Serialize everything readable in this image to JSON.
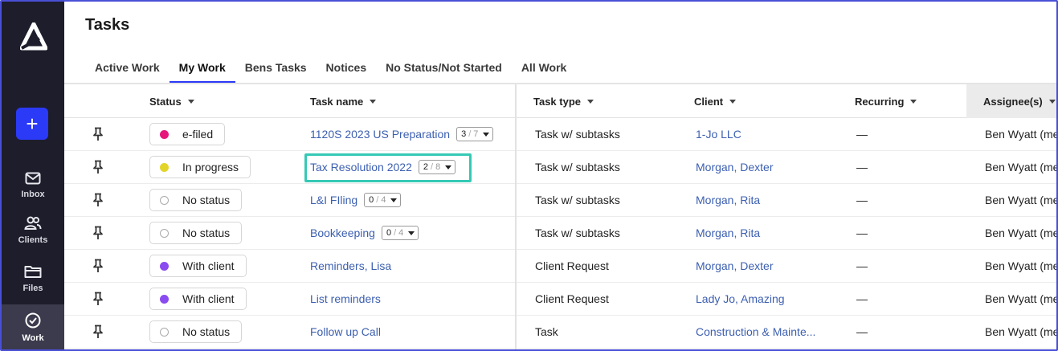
{
  "page": {
    "title": "Tasks"
  },
  "sidebar": {
    "add_label": "+",
    "items": [
      {
        "label": "Inbox",
        "icon": "envelope-icon"
      },
      {
        "label": "Clients",
        "icon": "people-icon"
      },
      {
        "label": "Files",
        "icon": "folder-icon"
      },
      {
        "label": "Work",
        "icon": "check-circle-icon"
      }
    ]
  },
  "tabs": [
    "Active Work",
    "My Work",
    "Bens Tasks",
    "Notices",
    "No Status/Not Started",
    "All Work"
  ],
  "active_tab": "My Work",
  "columns": {
    "status": "Status",
    "task_name": "Task name",
    "task_type": "Task type",
    "client": "Client",
    "recurring": "Recurring",
    "assignee": "Assignee(s)"
  },
  "rows": [
    {
      "status": "e-filed",
      "status_color": "#e6177a",
      "task": "1120S 2023 US Preparation",
      "done": "3",
      "total": "7",
      "type": "Task w/ subtasks",
      "client": "1-Jo LLC",
      "recurring": "—",
      "assignee": "Ben Wyatt (me"
    },
    {
      "status": "In progress",
      "status_color": "#e3d42a",
      "task": "Tax Resolution 2022",
      "done": "2",
      "total": "8",
      "type": "Task w/ subtasks",
      "client": "Morgan, Dexter",
      "recurring": "—",
      "assignee": "Ben Wyatt (me"
    },
    {
      "status": "No status",
      "status_color": "",
      "task": "L&I FIling",
      "done": "0",
      "total": "4",
      "type": "Task w/ subtasks",
      "client": "Morgan, Rita",
      "recurring": "—",
      "assignee": "Ben Wyatt (me"
    },
    {
      "status": "No status",
      "status_color": "",
      "task": "Bookkeeping",
      "done": "0",
      "total": "4",
      "type": "Task w/ subtasks",
      "client": "Morgan, Rita",
      "recurring": "—",
      "assignee": "Ben Wyatt (me"
    },
    {
      "status": "With client",
      "status_color": "#8a4bf0",
      "task": "Reminders, Lisa",
      "done": "",
      "total": "",
      "type": "Client Request",
      "client": "Morgan, Dexter",
      "recurring": "—",
      "assignee": "Ben Wyatt (me"
    },
    {
      "status": "With client",
      "status_color": "#8a4bf0",
      "task": "List reminders",
      "done": "",
      "total": "",
      "type": "Client Request",
      "client": "Lady Jo, Amazing",
      "recurring": "—",
      "assignee": "Ben Wyatt (me"
    },
    {
      "status": "No status",
      "status_color": "",
      "task": "Follow up Call",
      "done": "",
      "total": "",
      "type": "Task",
      "client": "Construction & Mainte...",
      "recurring": "—",
      "assignee": "Ben Wyatt (me"
    }
  ],
  "colors": {
    "accent": "#2b3af7",
    "sidebar": "#1d1d2c",
    "link": "#3c5fb0",
    "highlight": "#35c9b5"
  }
}
